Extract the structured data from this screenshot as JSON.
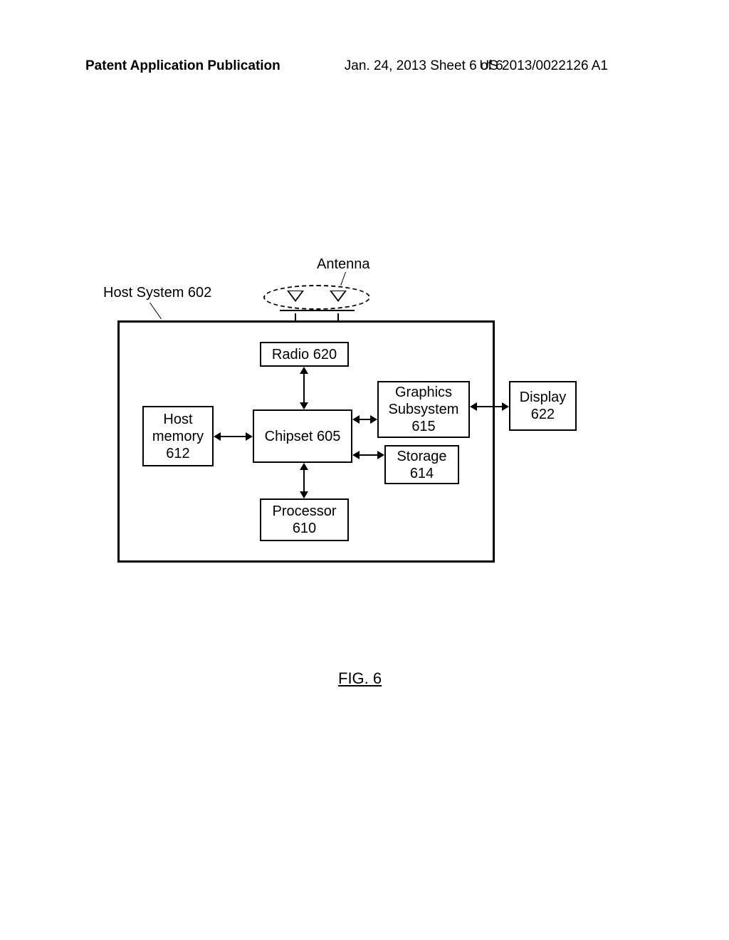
{
  "header": {
    "left": "Patent Application Publication",
    "mid": "Jan. 24, 2013  Sheet 6 of 6",
    "right": "US 2013/0022126 A1"
  },
  "labels": {
    "host_system": "Host System 602",
    "antenna": "Antenna"
  },
  "blocks": {
    "radio": "Radio 620",
    "chipset": "Chipset 605",
    "host_memory": "Host\nmemory\n612",
    "processor": "Processor\n610",
    "graphics": "Graphics\nSubsystem\n615",
    "storage": "Storage\n614",
    "display": "Display\n622"
  },
  "figure_label": "FIG. 6"
}
